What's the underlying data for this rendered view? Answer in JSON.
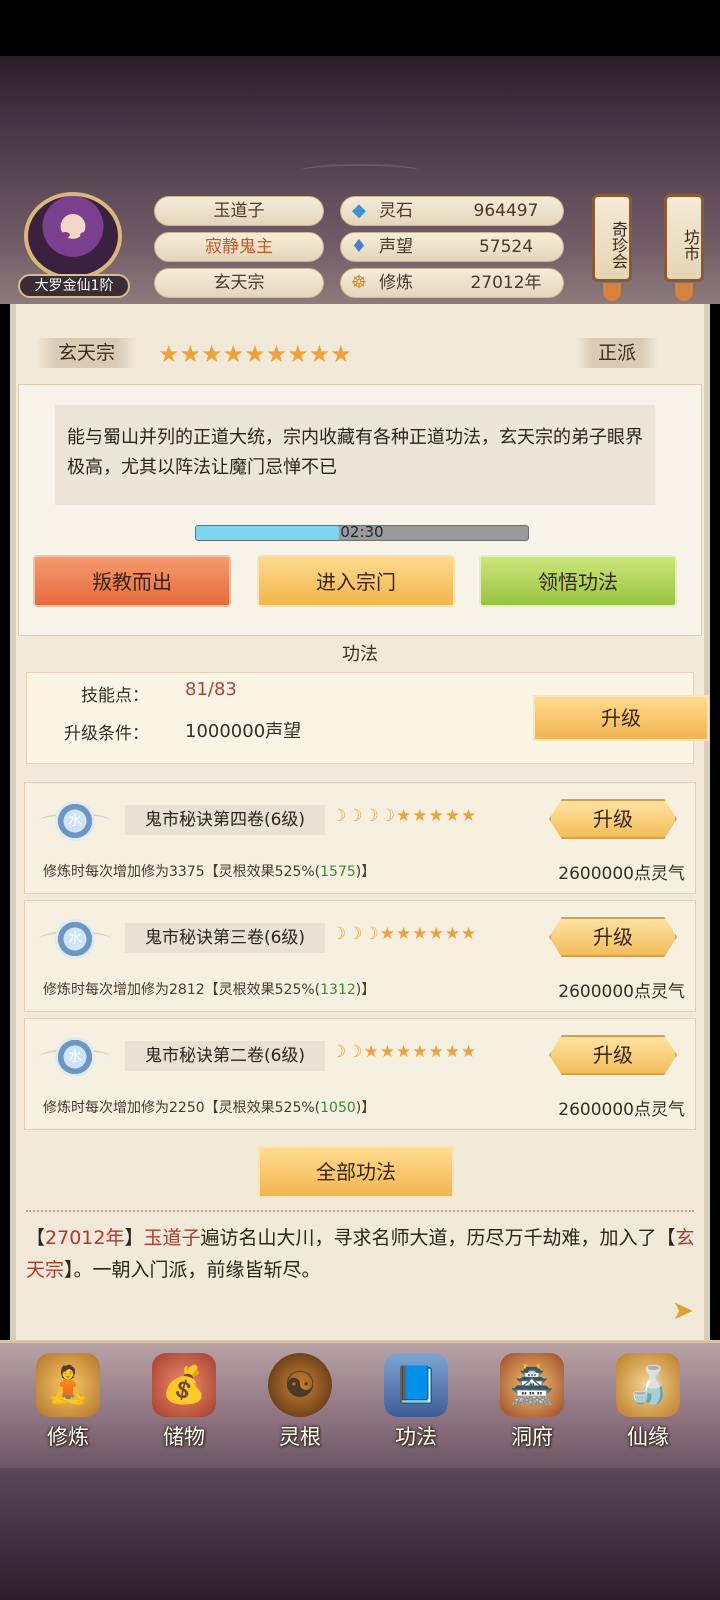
{
  "profile": {
    "rank_badge": "大罗金仙1阶",
    "name": "玉道子",
    "title": "寂静鬼主",
    "sect": "玄天宗"
  },
  "resources": [
    {
      "icon": "spirit-stone-icon",
      "label": "灵石",
      "value": "964497"
    },
    {
      "icon": "prestige-icon",
      "label": "声望",
      "value": "57524"
    },
    {
      "icon": "cultivation-icon",
      "label": "修炼",
      "value": "27012年"
    }
  ],
  "side_buttons": {
    "treasure": "奇珍会",
    "market": "坊市"
  },
  "sect_info": {
    "name": "玄天宗",
    "stars": "★★★★★★★★★",
    "alignment": "正派",
    "description": "能与蜀山并列的正道大统，宗内收藏有各种正道功法，玄天宗的弟子眼界极高，尤其以阵法让魔门忌惮不已",
    "timer": "02:30",
    "timer_progress": 0.43,
    "buttons": {
      "leave": "叛教而出",
      "enter": "进入宗门",
      "learn": "领悟功法"
    }
  },
  "skills_section": {
    "title": "功法",
    "points_label": "技能点：",
    "points_value": "81/83",
    "condition_label": "升级条件：",
    "condition_value": "1000000声望",
    "upgrade_label": "升级"
  },
  "techniques": [
    {
      "element": "水",
      "name": "鬼市秘诀第四卷(6级)",
      "moons": "☽☽☽☽",
      "stars": "★★★★★",
      "desc_pre": "修炼时每次增加修为3375【灵根效果525%(",
      "desc_green": "1575",
      "desc_post": ")】",
      "cost": "2600000点灵气",
      "button": "升级"
    },
    {
      "element": "水",
      "name": "鬼市秘诀第三卷(6级)",
      "moons": "☽☽☽",
      "stars": "★★★★★★",
      "desc_pre": "修炼时每次增加修为2812【灵根效果525%(",
      "desc_green": "1312",
      "desc_post": ")】",
      "cost": "2600000点灵气",
      "button": "升级"
    },
    {
      "element": "水",
      "name": "鬼市秘诀第二卷(6级)",
      "moons": "☽☽",
      "stars": "★★★★★★★",
      "desc_pre": "修炼时每次增加修为2250【灵根效果525%(",
      "desc_green": "1050",
      "desc_post": ")】",
      "cost": "2600000点灵气",
      "button": "升级"
    }
  ],
  "all_techniques_button": "全部功法",
  "story": {
    "p1": "【",
    "year": "27012年",
    "p2": "】",
    "name": "玉道子",
    "p3": "遍访名山大川，寻求名师大道，历尽万千劫难，加入了【",
    "sect": "玄天宗",
    "p4": "】。一朝入门派，前缘皆斩尽。"
  },
  "bottom_nav": [
    {
      "icon": "cultivate-icon",
      "label": "修炼"
    },
    {
      "icon": "storage-bag-icon",
      "label": "储物"
    },
    {
      "icon": "spirit-root-icon",
      "label": "灵根"
    },
    {
      "icon": "technique-book-icon",
      "label": "功法"
    },
    {
      "icon": "cave-house-icon",
      "label": "洞府"
    },
    {
      "icon": "fortune-gourd-icon",
      "label": "仙缘"
    }
  ],
  "colors": {
    "accent_gold": "#f3b552",
    "accent_red": "#e66a3e",
    "accent_green": "#98c340",
    "text_red": "#b03a2e"
  }
}
